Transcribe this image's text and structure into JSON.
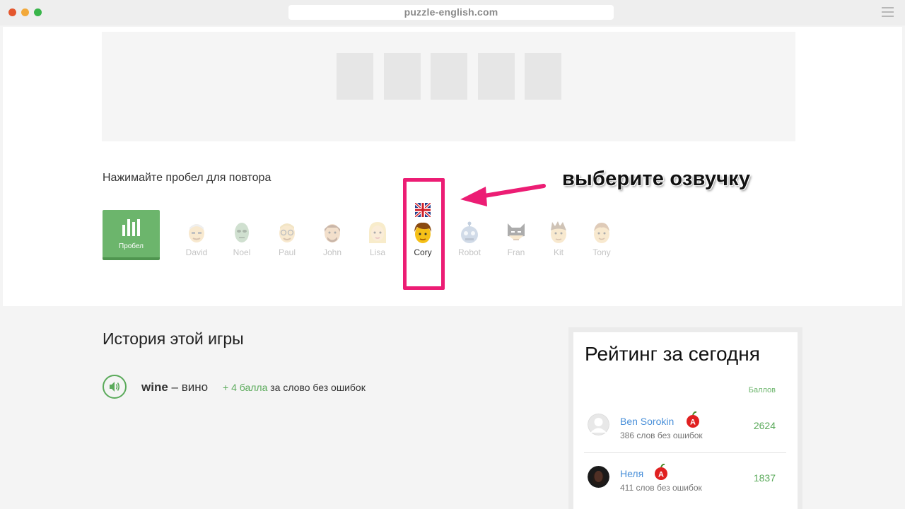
{
  "browser": {
    "url": "puzzle-english.com"
  },
  "game": {
    "hint": "Нажимайте пробел для повтора",
    "space_button": "Пробел",
    "voices": [
      "David",
      "Noel",
      "Paul",
      "John",
      "Lisa",
      "Cory",
      "Robot",
      "Fran",
      "Kit",
      "Tony"
    ],
    "selected_voice": "Cory"
  },
  "annotation": {
    "text": "выберите озвучку",
    "color": "#ec1d74"
  },
  "history": {
    "title": "История этой игры",
    "entries": [
      {
        "word": "wine",
        "translation": "– вино",
        "points": "+ 4 балла",
        "note": "за слово без ошибок"
      }
    ]
  },
  "rating": {
    "title": "Рейтинг за сегодня",
    "points_header": "Баллов",
    "users": [
      {
        "name": "Ben Sorokin",
        "sub": "386 слов без ошибок",
        "score": "2624",
        "badge": "A"
      },
      {
        "name": "Неля",
        "sub": "411 слов без ошибок",
        "score": "1837",
        "badge": "A"
      }
    ]
  },
  "colors": {
    "accent_green": "#6cb56c",
    "link_blue": "#4a90d9",
    "highlight_pink": "#ec1d74"
  }
}
